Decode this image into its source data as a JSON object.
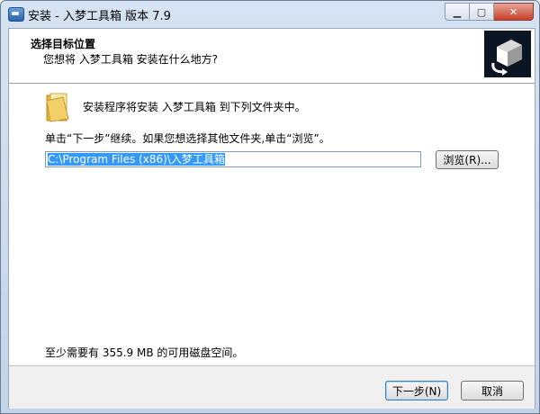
{
  "window": {
    "title": "安装 - 入梦工具箱 版本 7.9",
    "minimize": "▁",
    "maximize": "▢",
    "close": "✕"
  },
  "header": {
    "title": "选择目标位置",
    "subtitle": "您想将 入梦工具箱 安装在什么地方?"
  },
  "body": {
    "info": "安装程序将安装 入梦工具箱 到下列文件夹中。",
    "instruction": "单击“下一步”继续。如果您想选择其他文件夹,单击“浏览”。",
    "path_value": "C:\\Program Files (x86)\\入梦工具箱",
    "browse_label": "浏览(R)...",
    "space_text": "至少需要有 355.9 MB 的可用磁盘空间。"
  },
  "footer": {
    "next_label": "下一步(N)",
    "cancel_label": "取消"
  },
  "icons": [
    "app-icon",
    "folder-icon",
    "installer-logo-icon"
  ]
}
